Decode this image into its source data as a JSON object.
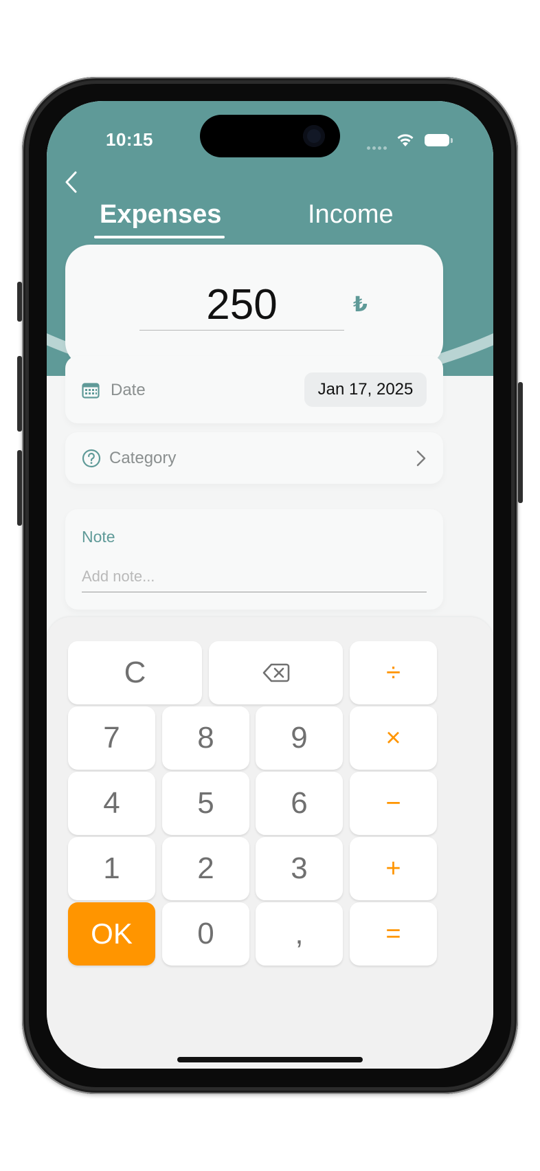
{
  "status_bar": {
    "time": "10:15"
  },
  "header": {
    "tabs": [
      {
        "label": "Expenses",
        "active": true
      },
      {
        "label": "Income",
        "active": false
      }
    ]
  },
  "amount": {
    "value": "250",
    "currency_symbol": "₺"
  },
  "date_row": {
    "label": "Date",
    "value": "Jan 17, 2025",
    "icon": "calendar-icon"
  },
  "category_row": {
    "label": "Category",
    "icon": "question-circle-icon"
  },
  "note": {
    "label": "Note",
    "placeholder": "Add note..."
  },
  "keypad": {
    "keys": {
      "clear": "C",
      "divide": "÷",
      "seven": "7",
      "eight": "8",
      "nine": "9",
      "multiply": "×",
      "four": "4",
      "five": "5",
      "six": "6",
      "minus": "−",
      "one": "1",
      "two": "2",
      "three": "3",
      "plus": "+",
      "ok": "OK",
      "zero": "0",
      "comma": ",",
      "equals": "="
    },
    "backspace_icon": "backspace-icon"
  },
  "colors": {
    "primary": "#5f9a98",
    "accent": "#ff9500",
    "background": "#f4f5f5"
  }
}
